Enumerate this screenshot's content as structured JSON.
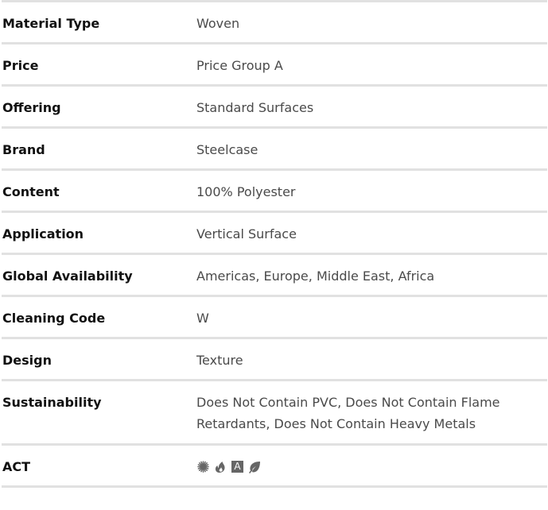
{
  "specs": [
    {
      "label": "Material Type",
      "value": "Woven"
    },
    {
      "label": "Price",
      "value": "Price Group A"
    },
    {
      "label": "Offering",
      "value": "Standard Surfaces"
    },
    {
      "label": "Brand",
      "value": "Steelcase"
    },
    {
      "label": "Content",
      "value": "100% Polyester"
    },
    {
      "label": "Application",
      "value": "Vertical Surface"
    },
    {
      "label": "Global Availability",
      "value": "Americas, Europe, Middle East, Africa"
    },
    {
      "label": "Cleaning Code",
      "value": "W"
    },
    {
      "label": "Design",
      "value": "Texture"
    },
    {
      "label": "Sustainability",
      "value": "Does Not Contain PVC, Does Not Contain Flame Retardants, Does Not Contain Heavy Metals"
    },
    {
      "label": "ACT",
      "icons": [
        "starburst-icon",
        "flame-icon",
        "letter-a-icon",
        "leaf-icon"
      ],
      "icon_letter": "A"
    }
  ],
  "colors": {
    "divider": "#e1e1e1",
    "label_text": "#111111",
    "value_text": "#4a4a4a",
    "icon": "#666666"
  }
}
